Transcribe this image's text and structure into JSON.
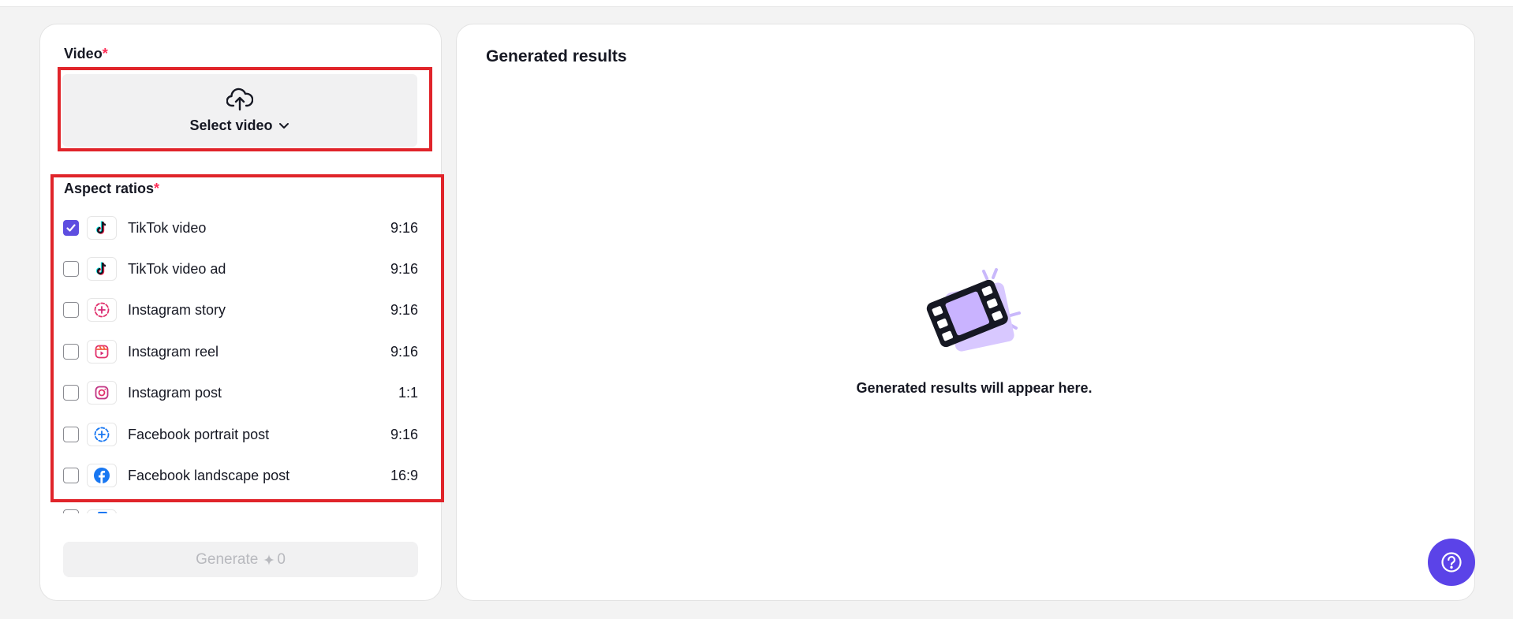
{
  "video_section": {
    "label": "Video",
    "required_mark": "*",
    "upload_label": "Select video"
  },
  "aspect_section": {
    "label": "Aspect ratios",
    "required_mark": "*",
    "items": [
      {
        "label": "TikTok video",
        "ratio": "9:16",
        "checked": true,
        "icon": "tiktok-icon"
      },
      {
        "label": "TikTok video ad",
        "ratio": "9:16",
        "checked": false,
        "icon": "tiktok-icon"
      },
      {
        "label": "Instagram story",
        "ratio": "9:16",
        "checked": false,
        "icon": "instagram-story-icon"
      },
      {
        "label": "Instagram reel",
        "ratio": "9:16",
        "checked": false,
        "icon": "instagram-reel-icon"
      },
      {
        "label": "Instagram post",
        "ratio": "1:1",
        "checked": false,
        "icon": "instagram-icon"
      },
      {
        "label": "Facebook portrait post",
        "ratio": "9:16",
        "checked": false,
        "icon": "facebook-story-icon"
      },
      {
        "label": "Facebook landscape post",
        "ratio": "16:9",
        "checked": false,
        "icon": "facebook-icon"
      }
    ]
  },
  "generate": {
    "label": "Generate",
    "credits": "0"
  },
  "results": {
    "title": "Generated results",
    "empty_text": "Generated results will appear here."
  },
  "colors": {
    "accent": "#5e4ee0",
    "required": "#fe2c55",
    "highlight": "#e0242a"
  }
}
